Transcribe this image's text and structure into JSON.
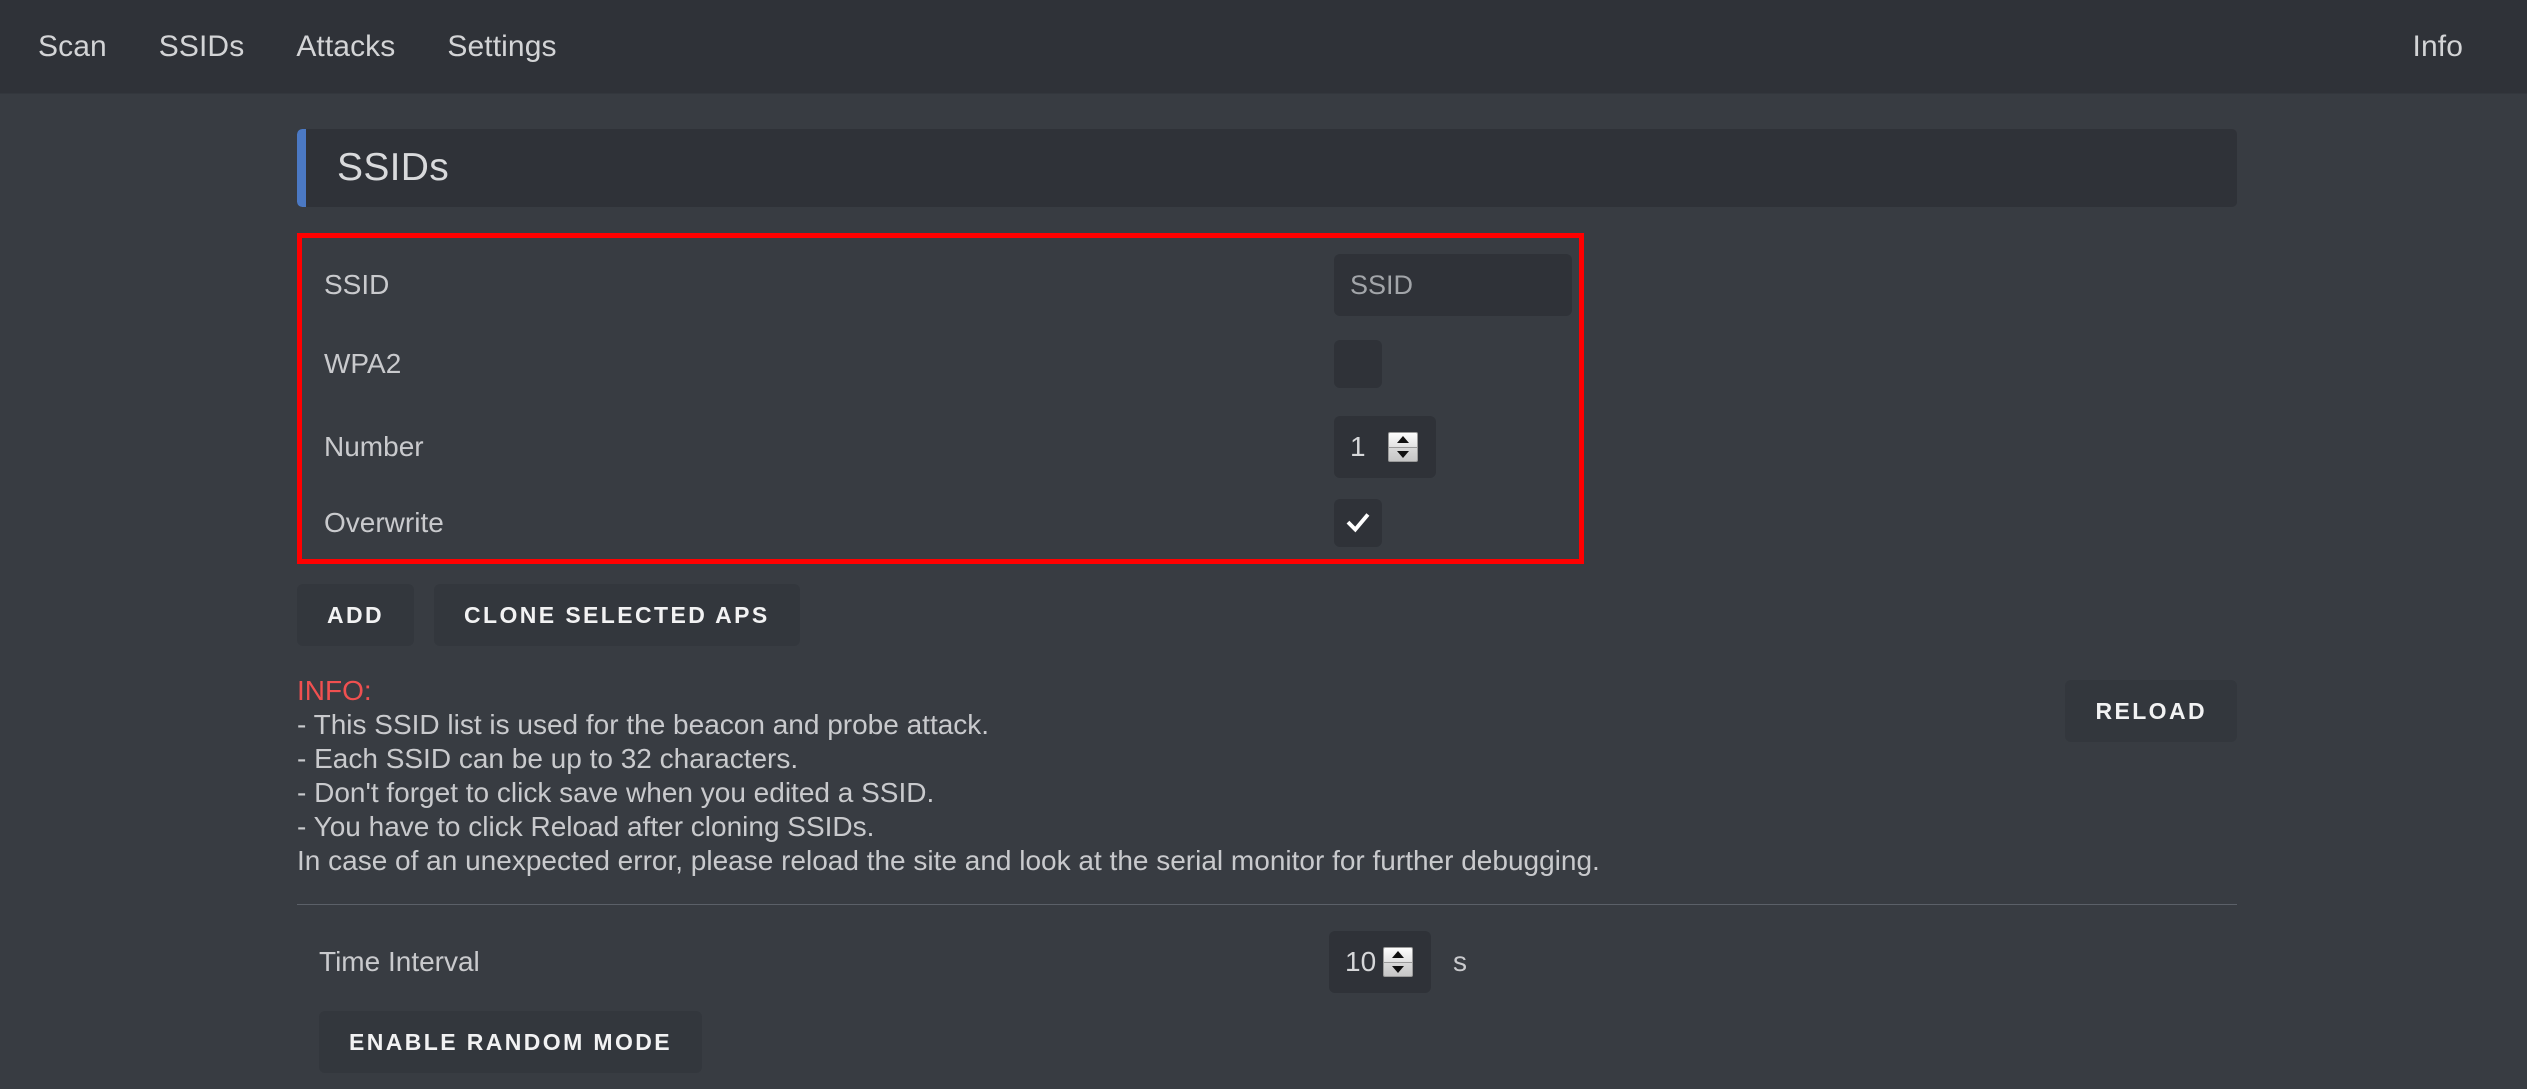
{
  "nav": {
    "items": [
      {
        "label": "Scan"
      },
      {
        "label": "SSIDs"
      },
      {
        "label": "Attacks"
      },
      {
        "label": "Settings"
      }
    ],
    "right_item": {
      "label": "Info"
    }
  },
  "page": {
    "title": "SSIDs",
    "accent_color": "#4b79c4",
    "highlight_color": "#ff0000"
  },
  "form": {
    "ssid": {
      "label": "SSID",
      "value": "",
      "placeholder": "SSID"
    },
    "wpa2": {
      "label": "WPA2",
      "checked": false
    },
    "number": {
      "label": "Number",
      "value": "1"
    },
    "overwrite": {
      "label": "Overwrite",
      "checked": true
    }
  },
  "actions": {
    "add_label": "ADD",
    "clone_label": "CLONE SELECTED APS",
    "reload_label": "RELOAD",
    "random_mode_label": "ENABLE RANDOM MODE"
  },
  "info": {
    "title": "INFO:",
    "lines": [
      "- This SSID list is used for the beacon and probe attack.",
      "- Each SSID can be up to 32 characters.",
      "- Don't forget to click save when you edited a SSID.",
      "- You have to click Reload after cloning SSIDs.",
      "In case of an unexpected error, please reload the site and look at the serial monitor for further debugging."
    ]
  },
  "time_interval": {
    "label": "Time Interval",
    "value": "10",
    "unit": "s"
  }
}
